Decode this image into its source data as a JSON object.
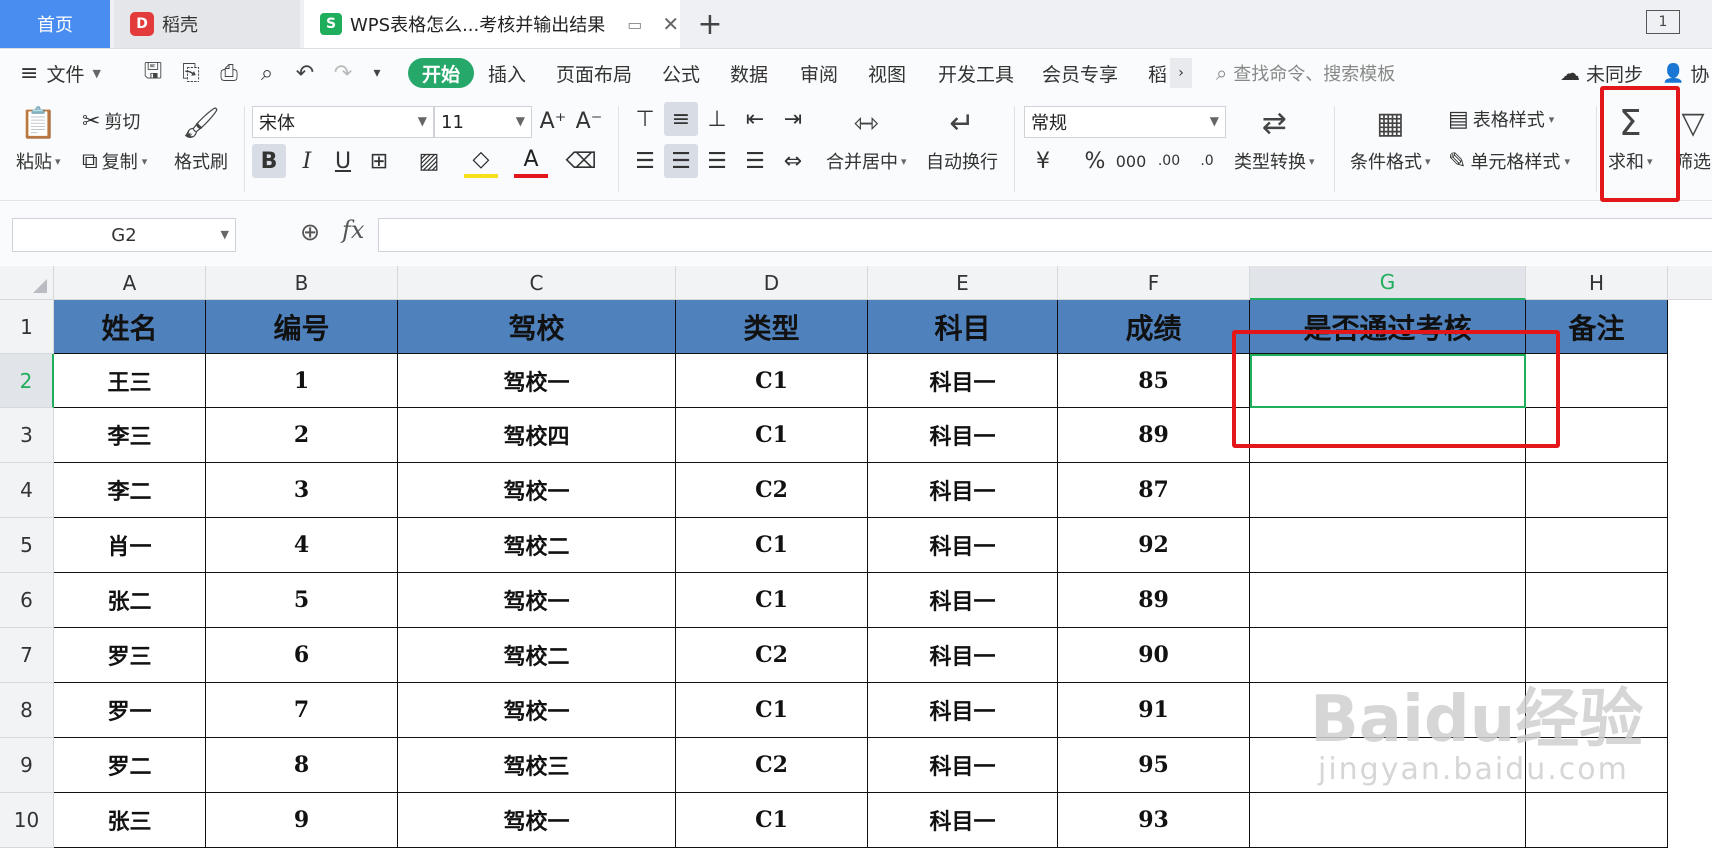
{
  "tabs": {
    "home": "首页",
    "daoke": "稻壳",
    "document": "WPS表格怎么...考核并输出结果"
  },
  "menu": {
    "file": "文件",
    "items": [
      "开始",
      "插入",
      "页面布局",
      "公式",
      "数据",
      "审阅",
      "视图",
      "开发工具",
      "会员专享",
      "稻"
    ],
    "search_placeholder": "查找命令、搜索模板",
    "sync": "未同步",
    "collab": "协"
  },
  "ribbon": {
    "paste": "粘贴",
    "cut": "剪切",
    "copy": "复制",
    "format_painter": "格式刷",
    "font_name": "宋体",
    "font_size": "11",
    "merge_center": "合并居中",
    "wrap_text": "自动换行",
    "number_format": "常规",
    "type_convert": "类型转换",
    "conditional_format": "条件格式",
    "table_style": "表格样式",
    "cell_style": "单元格样式",
    "sum": "求和",
    "filter": "筛选"
  },
  "formula_bar": {
    "name_box": "G2",
    "fx": "fx"
  },
  "grid": {
    "columns": [
      "A",
      "B",
      "C",
      "D",
      "E",
      "F",
      "G",
      "H"
    ],
    "rows": [
      "1",
      "2",
      "3",
      "4",
      "5",
      "6",
      "7",
      "8",
      "9",
      "10"
    ],
    "headers": [
      "姓名",
      "编号",
      "驾校",
      "类型",
      "科目",
      "成绩",
      "是否通过考核",
      "备注"
    ],
    "data": [
      [
        "王三",
        "1",
        "驾校一",
        "C1",
        "科目一",
        "85",
        "",
        ""
      ],
      [
        "李三",
        "2",
        "驾校四",
        "C1",
        "科目一",
        "89",
        "",
        ""
      ],
      [
        "李二",
        "3",
        "驾校一",
        "C2",
        "科目一",
        "87",
        "",
        ""
      ],
      [
        "肖一",
        "4",
        "驾校二",
        "C1",
        "科目一",
        "92",
        "",
        ""
      ],
      [
        "张二",
        "5",
        "驾校一",
        "C1",
        "科目一",
        "89",
        "",
        ""
      ],
      [
        "罗三",
        "6",
        "驾校二",
        "C2",
        "科目一",
        "90",
        "",
        ""
      ],
      [
        "罗一",
        "7",
        "驾校一",
        "C1",
        "科目一",
        "91",
        "",
        ""
      ],
      [
        "罗二",
        "8",
        "驾校三",
        "C2",
        "科目一",
        "95",
        "",
        ""
      ],
      [
        "张三",
        "9",
        "驾校一",
        "C1",
        "科目一",
        "93",
        "",
        ""
      ]
    ]
  },
  "watermark": {
    "main": "Baidu经验",
    "sub": "jingyan.baidu.com"
  },
  "colors": {
    "accent_green": "#1fae5b",
    "header_fill": "#4f81bd",
    "highlight_red": "#e3161a",
    "home_tab": "#4a8df0"
  }
}
